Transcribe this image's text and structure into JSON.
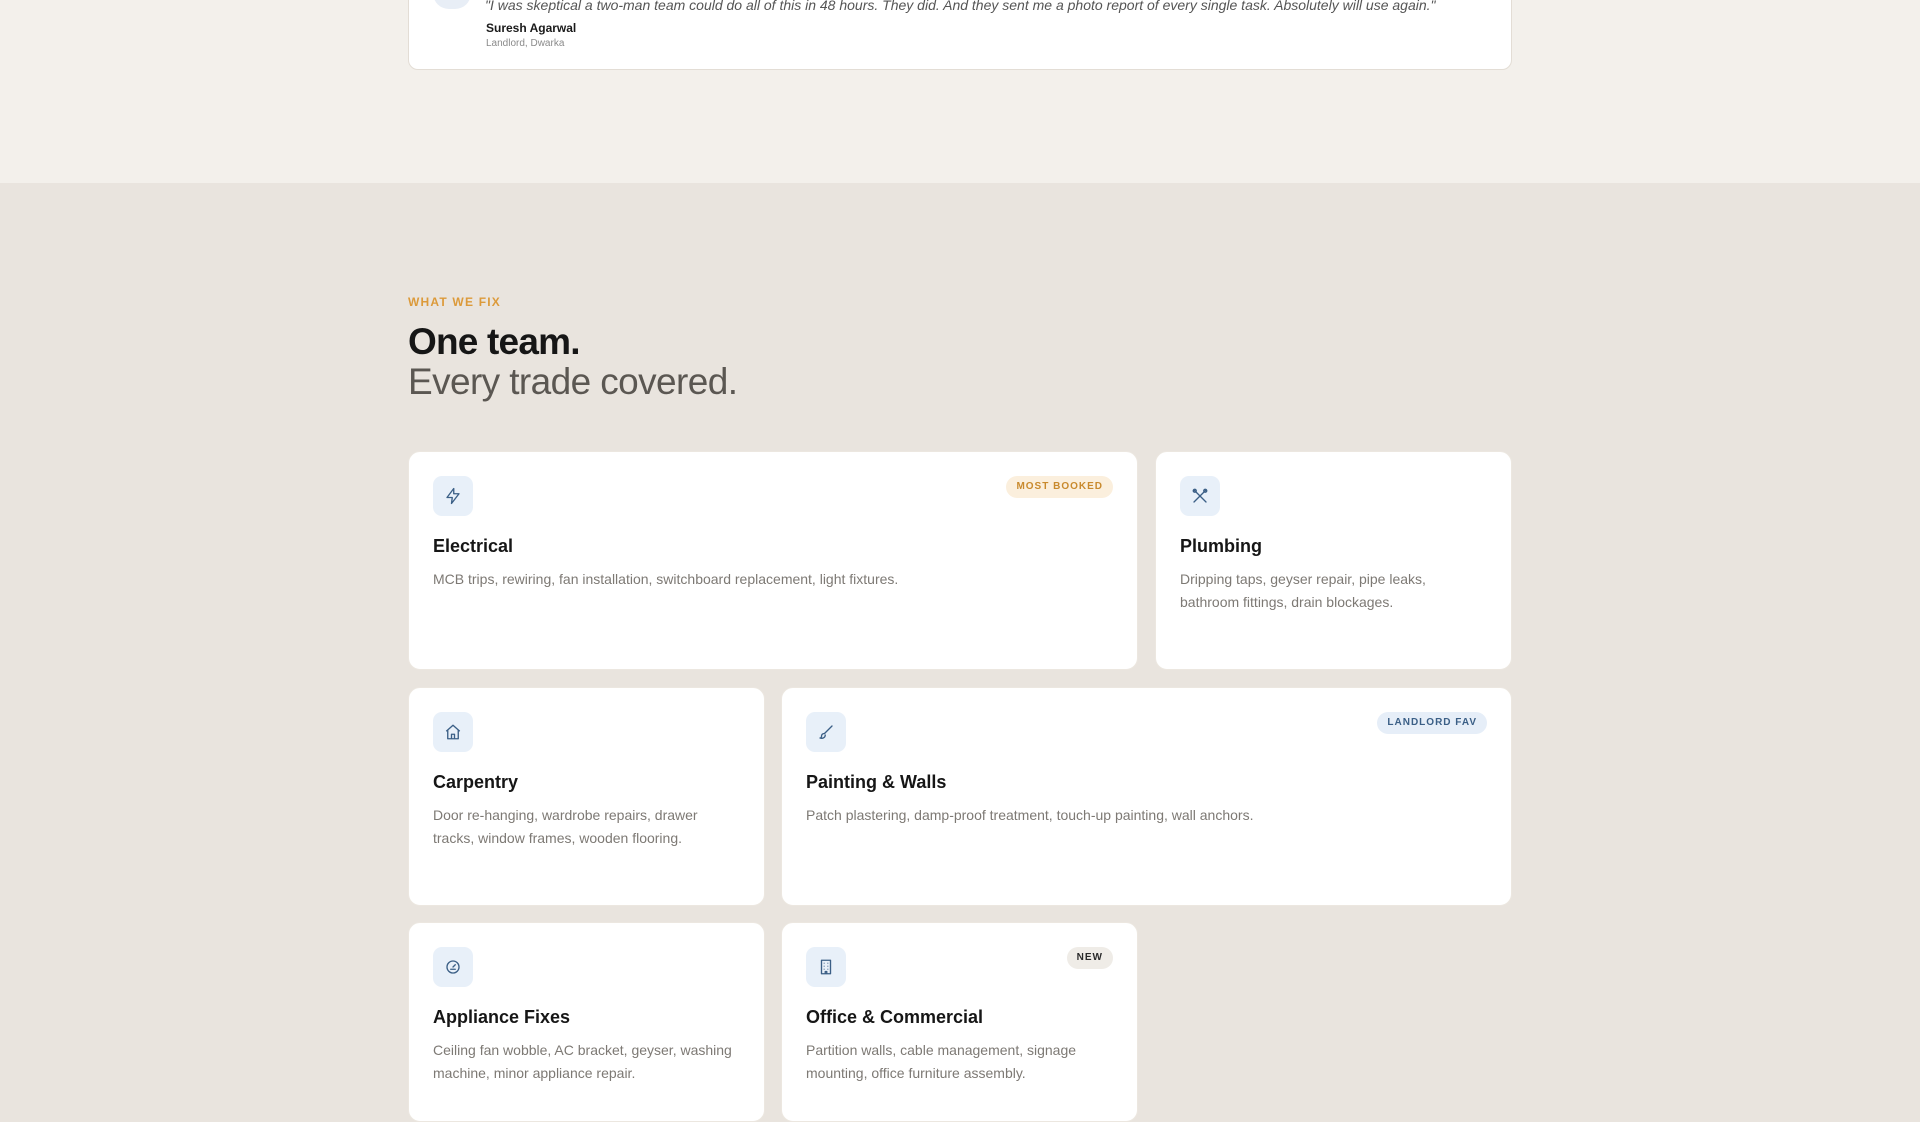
{
  "testimonial": {
    "quote": "\"I was skeptical a two-man team could do all of this in 48 hours. They did. And they sent me a photo report of every single task. Absolutely will use again.\"",
    "name": "Suresh Agarwal",
    "role": "Landlord, Dwarka"
  },
  "section": {
    "eyebrow": "WHAT WE FIX",
    "heading": "One team.",
    "subheading": "Every trade covered."
  },
  "services": [
    {
      "title": "Electrical",
      "description": "MCB trips, rewiring, fan installation, switchboard replacement, light fixtures.",
      "badge": "MOST BOOKED",
      "icon": "lightning-icon"
    },
    {
      "title": "Plumbing",
      "description": "Dripping taps, geyser repair, pipe leaks, bathroom fittings, drain blockages.",
      "badge": "",
      "icon": "tools-icon"
    },
    {
      "title": "Carpentry",
      "description": "Door re-hanging, wardrobe repairs, drawer tracks, window frames, wooden flooring.",
      "badge": "",
      "icon": "home-icon"
    },
    {
      "title": "Painting & Walls",
      "description": "Patch plastering, damp-proof treatment, touch-up painting, wall anchors.",
      "badge": "LANDLORD FAV",
      "icon": "brush-icon"
    },
    {
      "title": "Appliance Fixes",
      "description": "Ceiling fan wobble, AC bracket, geyser, washing machine, minor appliance repair.",
      "badge": "",
      "icon": "gauge-icon"
    },
    {
      "title": "Office & Commercial",
      "description": "Partition walls, cable management, signage mounting, office furniture assembly.",
      "badge": "NEW",
      "icon": "building-icon"
    }
  ],
  "colors": {
    "accent": "#dc9a3a",
    "icon_blue": "#3b5f86",
    "page_bg": "#e9e4de",
    "top_bg": "#f3f0eb"
  }
}
